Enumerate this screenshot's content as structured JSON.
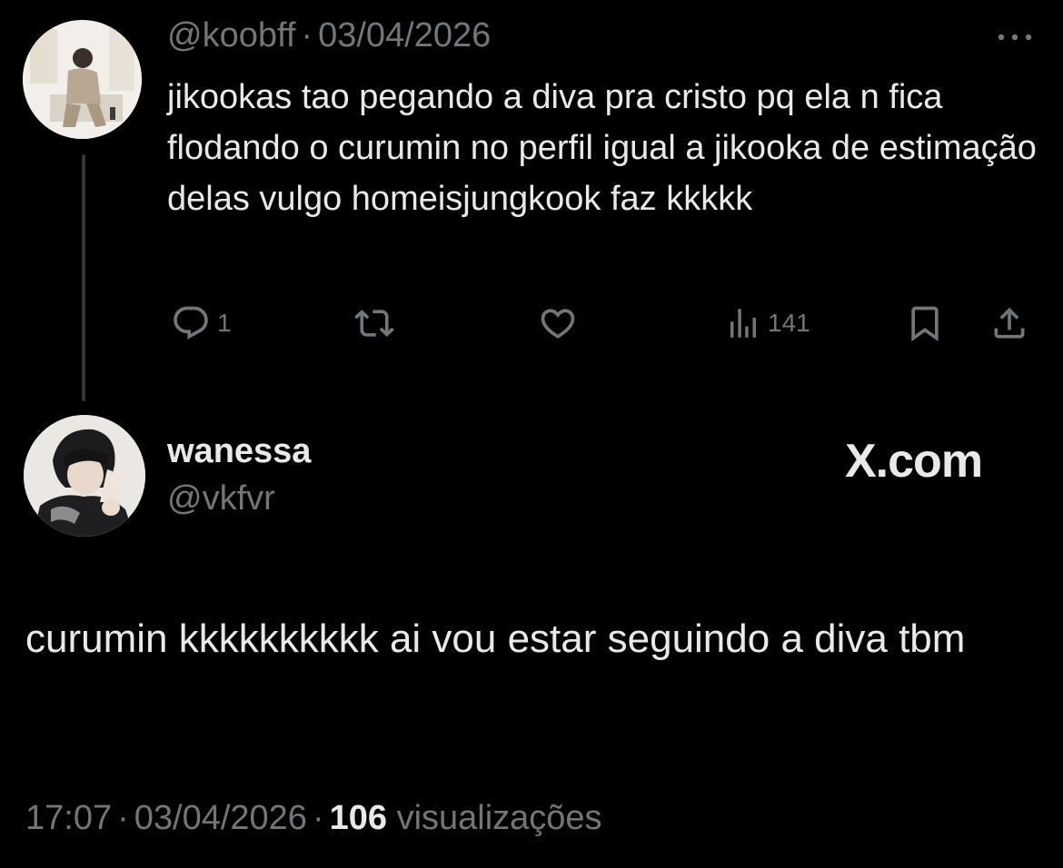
{
  "parent_tweet": {
    "handle": "@koobff",
    "date": "03/04/2026",
    "separator": "·",
    "text": "jikookas tao pegando a diva pra cristo pq ela n fica flodando o curumin no perfil igual a jikooka de estimação delas vulgo homeisjungkook faz kkkkk",
    "actions": {
      "reply_count": "1",
      "views_count": "141"
    },
    "icons": [
      "more-icon",
      "reply-icon",
      "retweet-icon",
      "like-icon",
      "views-icon",
      "bookmark-icon",
      "share-icon"
    ]
  },
  "main_tweet": {
    "display_name": "wanessa",
    "handle": "@vkfvr",
    "watermark": "X.com",
    "text": "curumin kkkkkkkkkk ai vou estar seguindo a diva tbm",
    "footer": {
      "time": "17:07",
      "date": "03/04/2026",
      "separator": "·",
      "views_count": "106",
      "views_label": "visualizações"
    }
  },
  "colors": {
    "background": "#000000",
    "primary_text": "#e7e9ea",
    "secondary_text": "#71767b",
    "thread_line": "#333639"
  }
}
